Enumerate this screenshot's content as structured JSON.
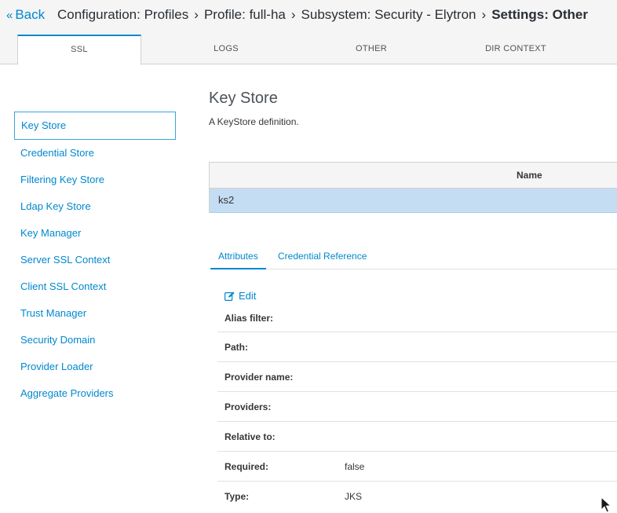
{
  "breadcrumb": {
    "back_label": "Back",
    "items": [
      "Configuration: Profiles",
      "Profile: full-ha",
      "Subsystem: Security - Elytron"
    ],
    "current": "Settings: Other"
  },
  "tabs": [
    {
      "label": "SSL",
      "active": true
    },
    {
      "label": "LOGS",
      "active": false
    },
    {
      "label": "OTHER",
      "active": false
    },
    {
      "label": "DIR CONTEXT",
      "active": false
    }
  ],
  "sidebar": {
    "items": [
      {
        "label": "Key Store",
        "active": true
      },
      {
        "label": "Credential Store"
      },
      {
        "label": "Filtering Key Store"
      },
      {
        "label": "Ldap Key Store"
      },
      {
        "label": "Key Manager"
      },
      {
        "label": "Server SSL Context"
      },
      {
        "label": "Client SSL Context"
      },
      {
        "label": "Trust Manager"
      },
      {
        "label": "Security Domain"
      },
      {
        "label": "Provider Loader"
      },
      {
        "label": "Aggregate Providers"
      }
    ]
  },
  "main": {
    "title": "Key Store",
    "description": "A KeyStore definition.",
    "table": {
      "column": "Name",
      "rows": [
        "ks2"
      ]
    },
    "subtabs": [
      "Attributes",
      "Credential Reference"
    ],
    "edit_label": "Edit",
    "attributes": [
      {
        "label": "Alias filter:",
        "value": ""
      },
      {
        "label": "Path:",
        "value": ""
      },
      {
        "label": "Provider name:",
        "value": ""
      },
      {
        "label": "Providers:",
        "value": ""
      },
      {
        "label": "Relative to:",
        "value": ""
      },
      {
        "label": "Required:",
        "value": "false"
      },
      {
        "label": "Type:",
        "value": "JKS"
      }
    ]
  },
  "colors": {
    "link": "#0088ce",
    "selected_row": "#c4ddf3",
    "header_bg": "#f5f5f5"
  }
}
